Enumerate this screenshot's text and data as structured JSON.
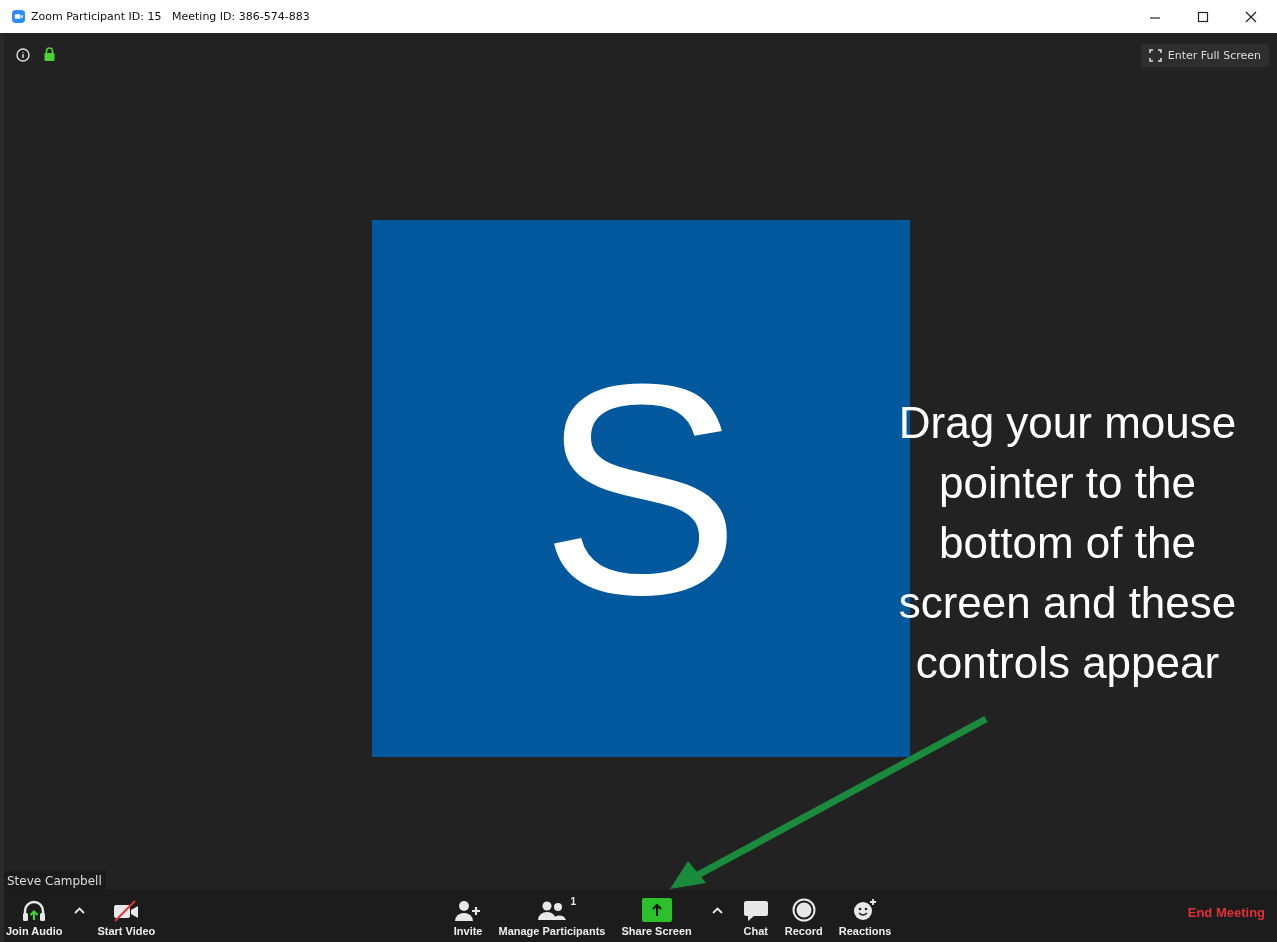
{
  "window": {
    "title": "Zoom Participant ID: 15   Meeting ID: 386-574-883"
  },
  "top_bar": {
    "full_screen": "Enter Full Screen",
    "locked": true
  },
  "video": {
    "avatar_letter": "S",
    "participant_name": "Steve Campbell"
  },
  "callout": {
    "text": "Drag your mouse pointer to the bottom of the screen and these controls appear"
  },
  "toolbar": {
    "left": [
      {
        "kind": "audio",
        "label": "Join Audio"
      },
      {
        "kind": "caret"
      },
      {
        "kind": "video",
        "label": "Start Video",
        "off": true
      }
    ],
    "center": [
      {
        "kind": "invite",
        "label": "Invite"
      },
      {
        "kind": "participants",
        "label": "Manage Participants",
        "count": "1"
      },
      {
        "kind": "share",
        "label": "Share Screen"
      },
      {
        "kind": "caret"
      },
      {
        "kind": "chat",
        "label": "Chat"
      },
      {
        "kind": "record",
        "label": "Record"
      },
      {
        "kind": "reactions",
        "label": "Reactions"
      }
    ],
    "end": "End Meeting"
  }
}
